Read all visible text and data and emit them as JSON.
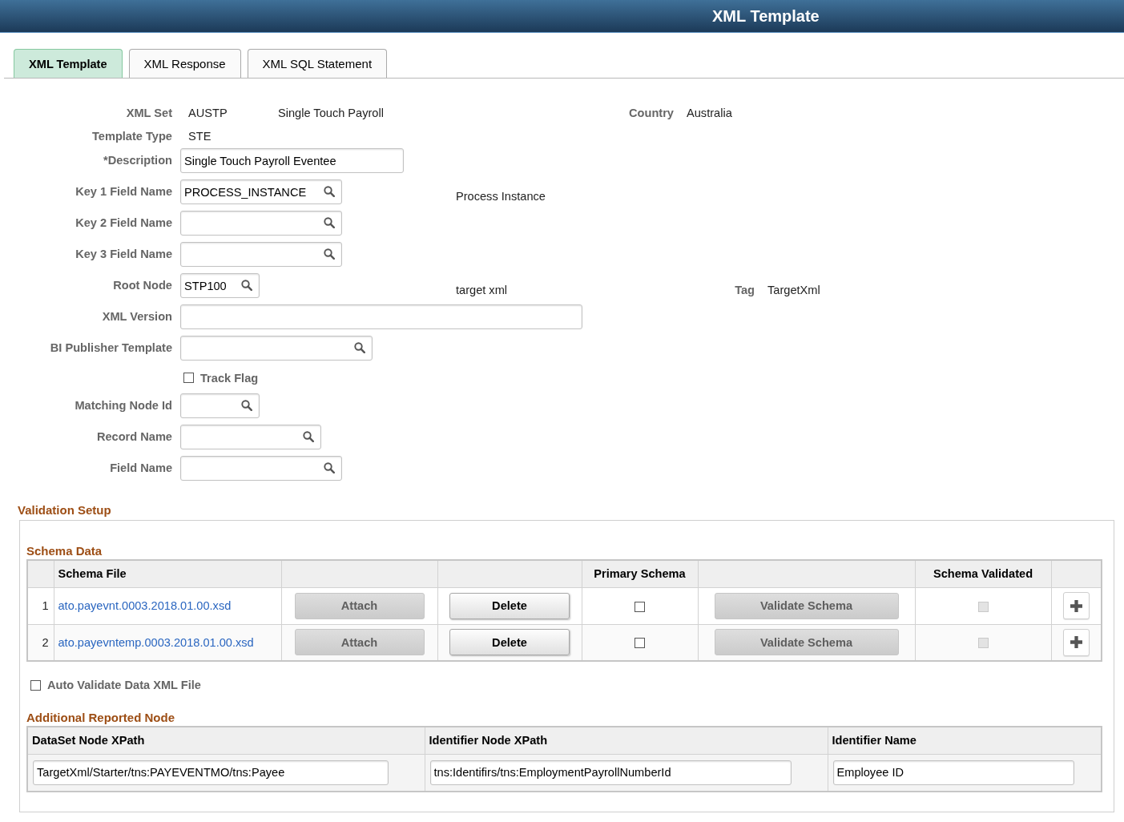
{
  "header": {
    "title": "XML Template"
  },
  "tabs": [
    {
      "label": "XML Template",
      "selected": true
    },
    {
      "label": "XML Response",
      "selected": false
    },
    {
      "label": "XML SQL Statement",
      "selected": false
    }
  ],
  "form": {
    "fields": [
      {
        "kind": "display",
        "label": "XML Set",
        "value": "AUSTP",
        "description": "Single Touch Payroll",
        "side_label": "Country",
        "side_value": "Australia"
      },
      {
        "kind": "display",
        "label": "Template Type",
        "value": "STE"
      },
      {
        "kind": "text_input",
        "label": "*Description",
        "value": "Single Touch Payroll Eventee"
      },
      {
        "kind": "lookup",
        "label": "Key 1 Field Name",
        "value": "PROCESS_INSTANCE",
        "description": "Process Instance"
      },
      {
        "kind": "lookup",
        "label": "Key 2 Field Name"
      },
      {
        "kind": "lookup",
        "label": "Key 3 Field Name"
      },
      {
        "kind": "lookup",
        "label": "Root Node",
        "value": "STP100",
        "description": "target xml",
        "side_label": "Tag",
        "side_value": "TargetXml"
      },
      {
        "kind": "text_input",
        "label": "XML Version"
      },
      {
        "kind": "lookup",
        "label": "BI Publisher Template"
      },
      {
        "kind": "checkbox",
        "label": "Track Flag",
        "checked": false
      },
      {
        "kind": "lookup",
        "label": "Matching Node Id"
      },
      {
        "kind": "lookup",
        "label": "Record Name"
      },
      {
        "kind": "lookup",
        "label": "Field Name"
      }
    ]
  },
  "validation_setup": {
    "title": "Validation Setup",
    "schema_data": {
      "title": "Schema Data",
      "columns": [
        {
          "kind": "row_number"
        },
        {
          "kind": "schema_file",
          "label": "Schema File"
        },
        {
          "kind": "attach"
        },
        {
          "kind": "delete"
        },
        {
          "kind": "primary_schema",
          "label": "Primary Schema"
        },
        {
          "kind": "validate"
        },
        {
          "kind": "schema_validated",
          "label": "Schema Validated"
        },
        {
          "kind": "add_row"
        }
      ],
      "rows": [
        {
          "row_number": "1",
          "schema_file": "ato.payevnt.0003.2018.01.00.xsd",
          "attach": {
            "label": "Attach",
            "disabled": true
          },
          "delete": {
            "label": "Delete",
            "disabled": false
          },
          "primary_schema": {
            "checked": false,
            "disabled": false
          },
          "validate": {
            "label": "Validate Schema",
            "disabled": true
          },
          "schema_validated": {
            "checked": false,
            "disabled": true
          }
        },
        {
          "row_number": "2",
          "schema_file": "ato.payevntemp.0003.2018.01.00.xsd",
          "attach": {
            "label": "Attach",
            "disabled": true
          },
          "delete": {
            "label": "Delete",
            "disabled": false
          },
          "primary_schema": {
            "checked": false,
            "disabled": false
          },
          "validate": {
            "label": "Validate Schema",
            "disabled": true
          },
          "schema_validated": {
            "checked": false,
            "disabled": true
          }
        }
      ]
    },
    "auto_validate": {
      "label": "Auto Validate Data XML File",
      "checked": false
    },
    "additional_reported_node": {
      "title": "Additional Reported Node",
      "columns": [
        "DataSet Node XPath",
        "Identifier Node XPath",
        "Identifier Name"
      ],
      "rows": [
        [
          "TargetXml/Starter/tns:PAYEVENTMO/tns:Payee",
          "tns:Identifirs/tns:EmploymentPayrollNumberId",
          "Employee ID"
        ]
      ]
    }
  }
}
